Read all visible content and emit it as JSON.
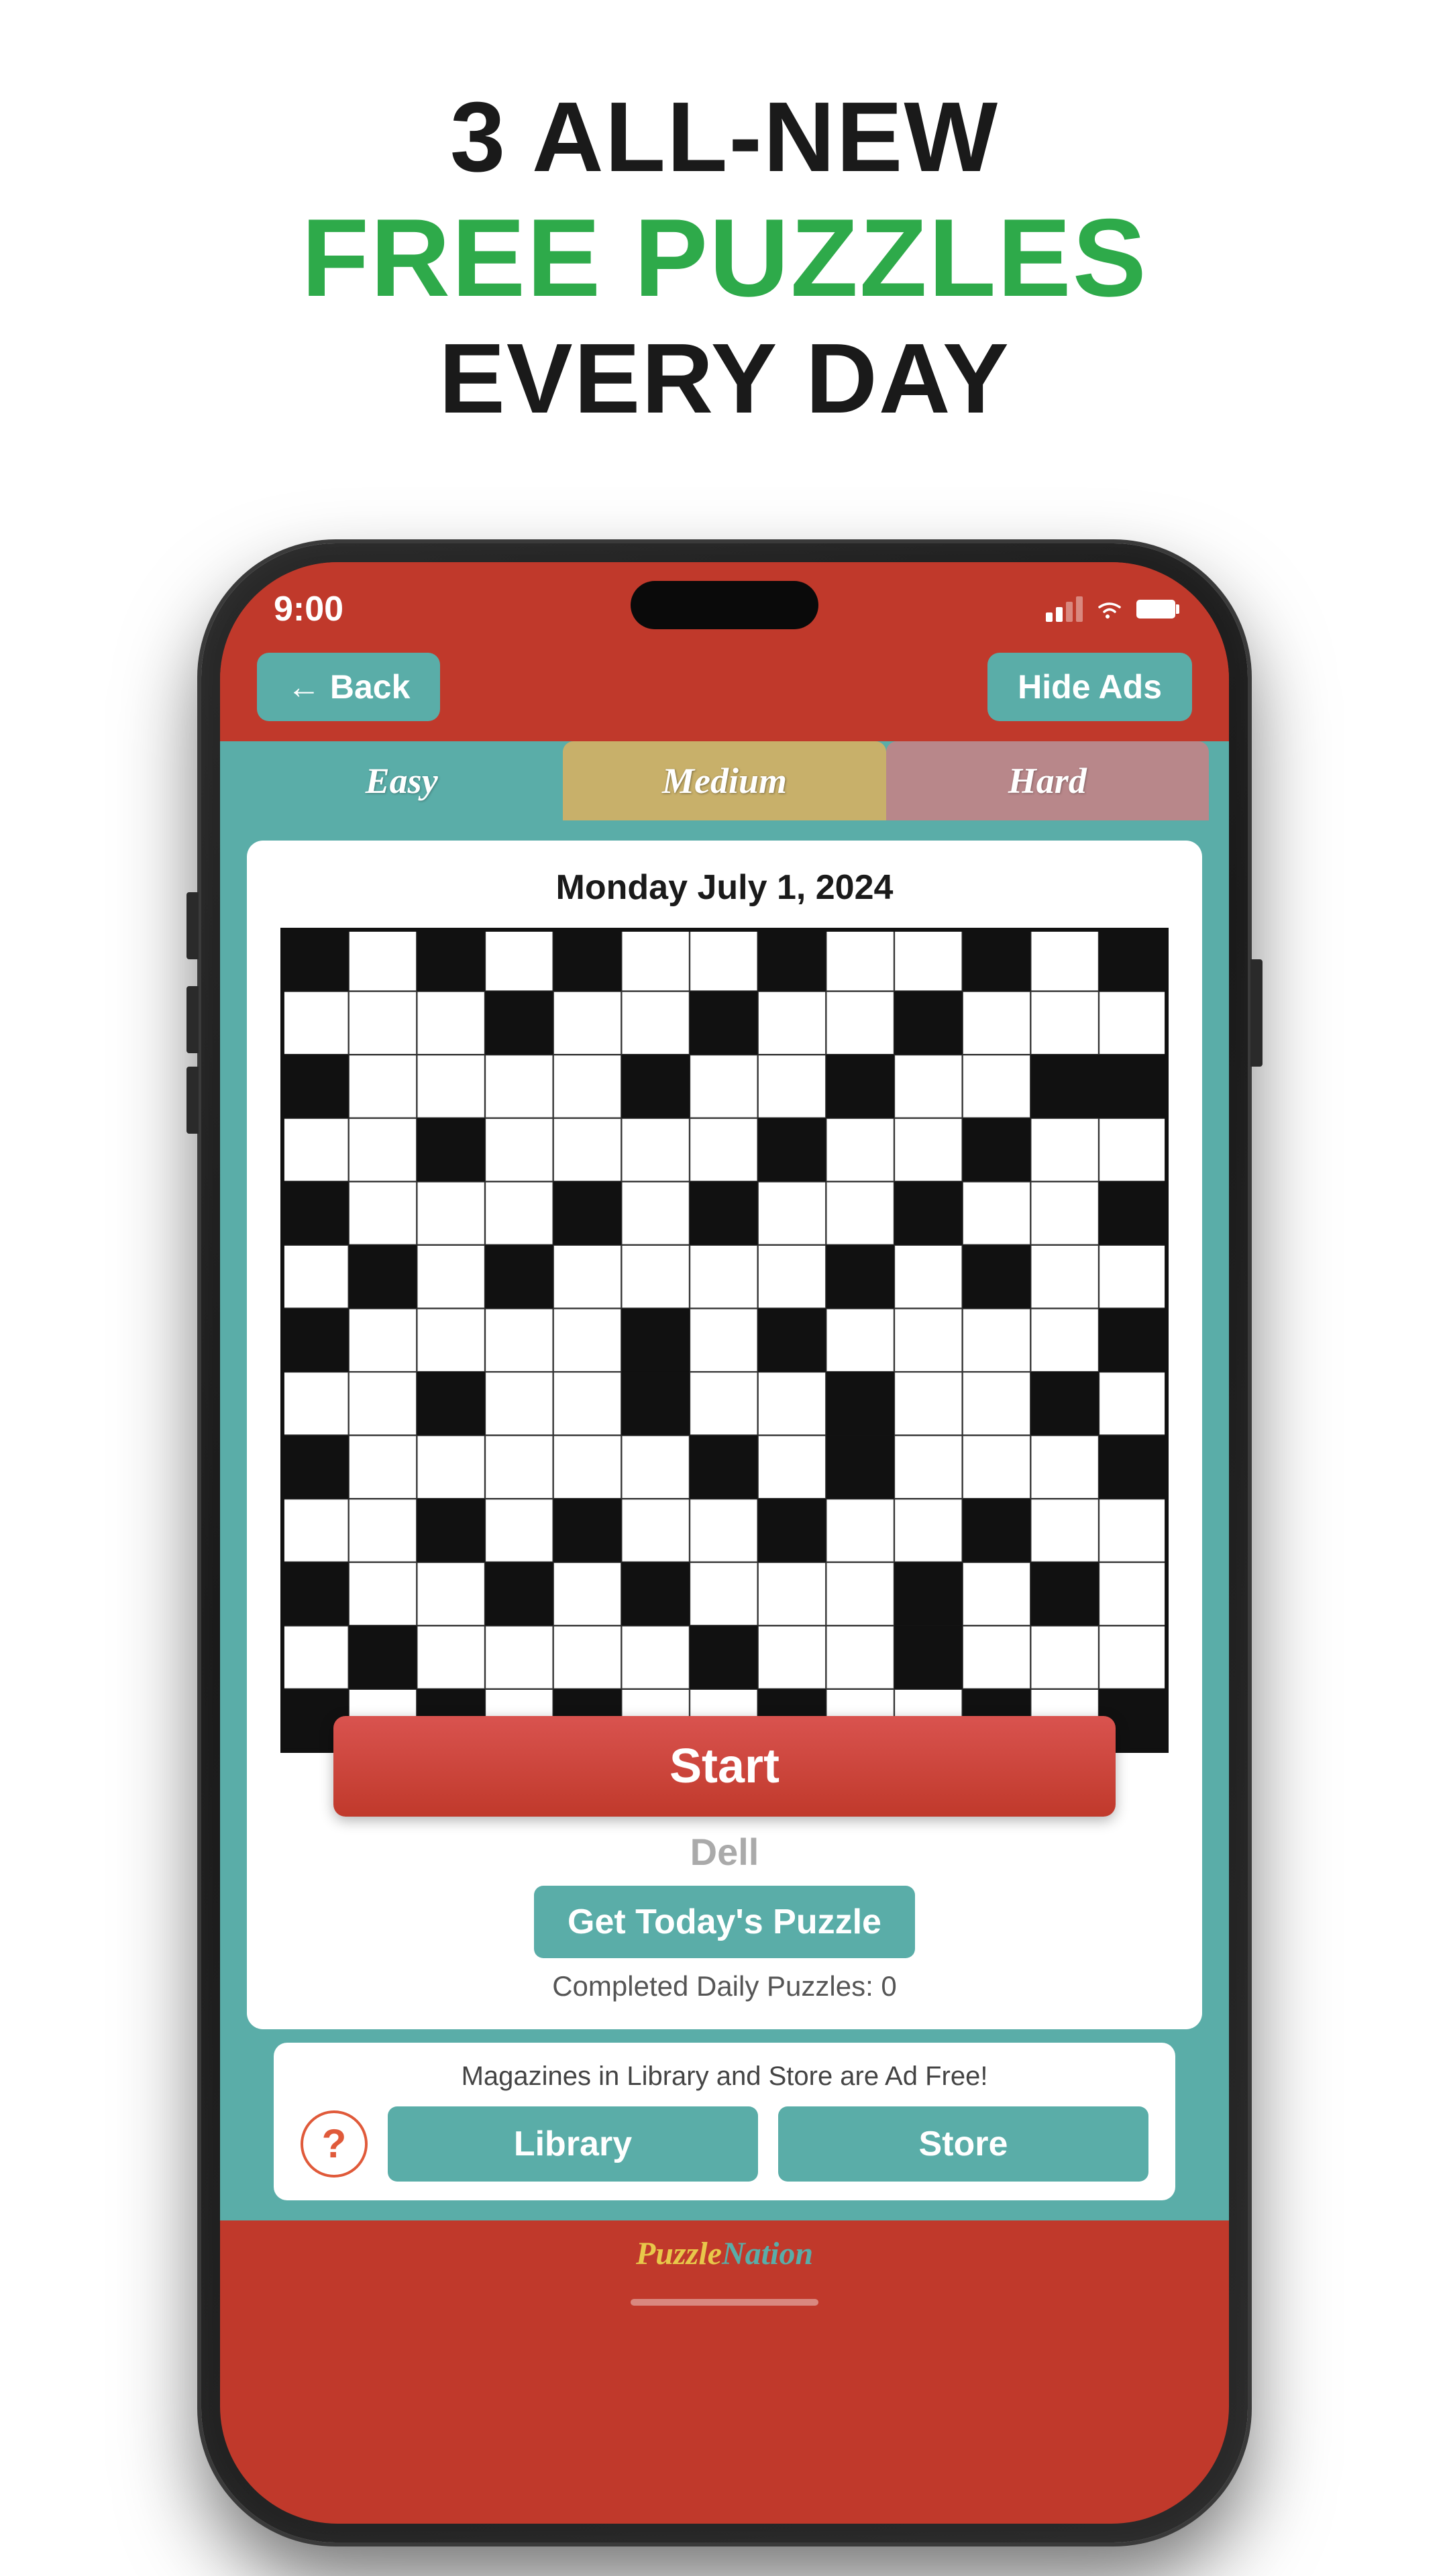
{
  "headline": {
    "line1": "3 ALL-NEW",
    "line2": "FREE PUZZLES",
    "line3": "EVERY DAY"
  },
  "status_bar": {
    "time": "9:00",
    "signal": "signal",
    "wifi": "wifi",
    "battery": "battery"
  },
  "nav": {
    "back_label": "← Back",
    "hide_ads_label": "Hide Ads"
  },
  "tabs": [
    {
      "id": "easy",
      "label": "Easy"
    },
    {
      "id": "medium",
      "label": "Medium"
    },
    {
      "id": "hard",
      "label": "Hard"
    }
  ],
  "puzzle": {
    "date": "Monday July 1, 2024",
    "start_label": "Start",
    "publisher": "Dell",
    "get_puzzle_label": "Get Today's Puzzle",
    "completed_label": "Completed Daily Puzzles: 0"
  },
  "bottom": {
    "ad_free_text": "Magazines in Library and Store are Ad Free!",
    "help_icon": "?",
    "library_label": "Library",
    "store_label": "Store"
  },
  "footer": {
    "logo_text": "PuzzleNation"
  }
}
